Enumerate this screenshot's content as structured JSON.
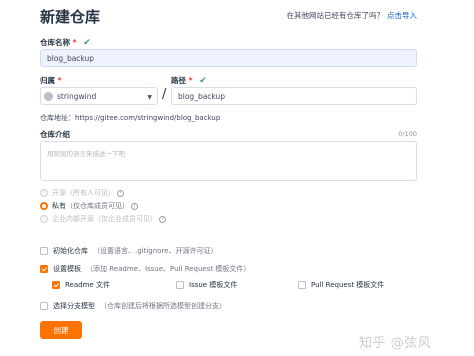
{
  "header": {
    "title": "新建仓库",
    "import_hint": "在其他网站已经有仓库了吗？",
    "import_link": "点击导入"
  },
  "repo_name": {
    "label": "仓库名称",
    "required_mark": "*",
    "check": "✔",
    "value": "blog_backup"
  },
  "owner": {
    "label": "归属",
    "required_mark": "*",
    "value": "stringwind",
    "caret": "▼"
  },
  "separator": "/",
  "path": {
    "label": "路径",
    "required_mark": "*",
    "check": "✔",
    "value": "blog_backup"
  },
  "repo_url": {
    "label": "仓库地址：",
    "value": "https://gitee.com/stringwind/blog_backup"
  },
  "description": {
    "label": "仓库介绍",
    "placeholder": "用简短的语言来描述一下吧",
    "counter": "0/100"
  },
  "visibility": {
    "options": [
      {
        "label": "开源",
        "hint": "（所有人可见）",
        "selected": false,
        "disabled": true
      },
      {
        "label": "私有",
        "hint": "（仅仓库成员可见）",
        "selected": true,
        "disabled": false
      },
      {
        "label": "企业内部开源",
        "hint": "（仅企业成员可见）",
        "selected": false,
        "disabled": true
      }
    ],
    "help": "?"
  },
  "init": {
    "label": "初始化仓库",
    "hint": "（设置语言、.gitignore、开源许可证）"
  },
  "template": {
    "label": "设置模板",
    "hint": "（添加 Readme、Issue、Pull Request 模板文件）",
    "files": [
      {
        "label": "Readme 文件",
        "checked": true
      },
      {
        "label": "Issue 模板文件",
        "checked": false
      },
      {
        "label": "Pull Request 模板文件",
        "checked": false
      }
    ]
  },
  "branch_model": {
    "label": "选择分支模型",
    "hint": "（仓库创建后将根据所选模型创建分支）"
  },
  "submit": {
    "label": "创建"
  },
  "watermark": "知乎 @弦风",
  "colors": {
    "accent": "#fe7300",
    "link": "#0d61c8",
    "success": "#39a35f",
    "required": "#e8393d"
  },
  "icons": [
    "check-icon",
    "help-icon",
    "chevron-down-icon"
  ]
}
